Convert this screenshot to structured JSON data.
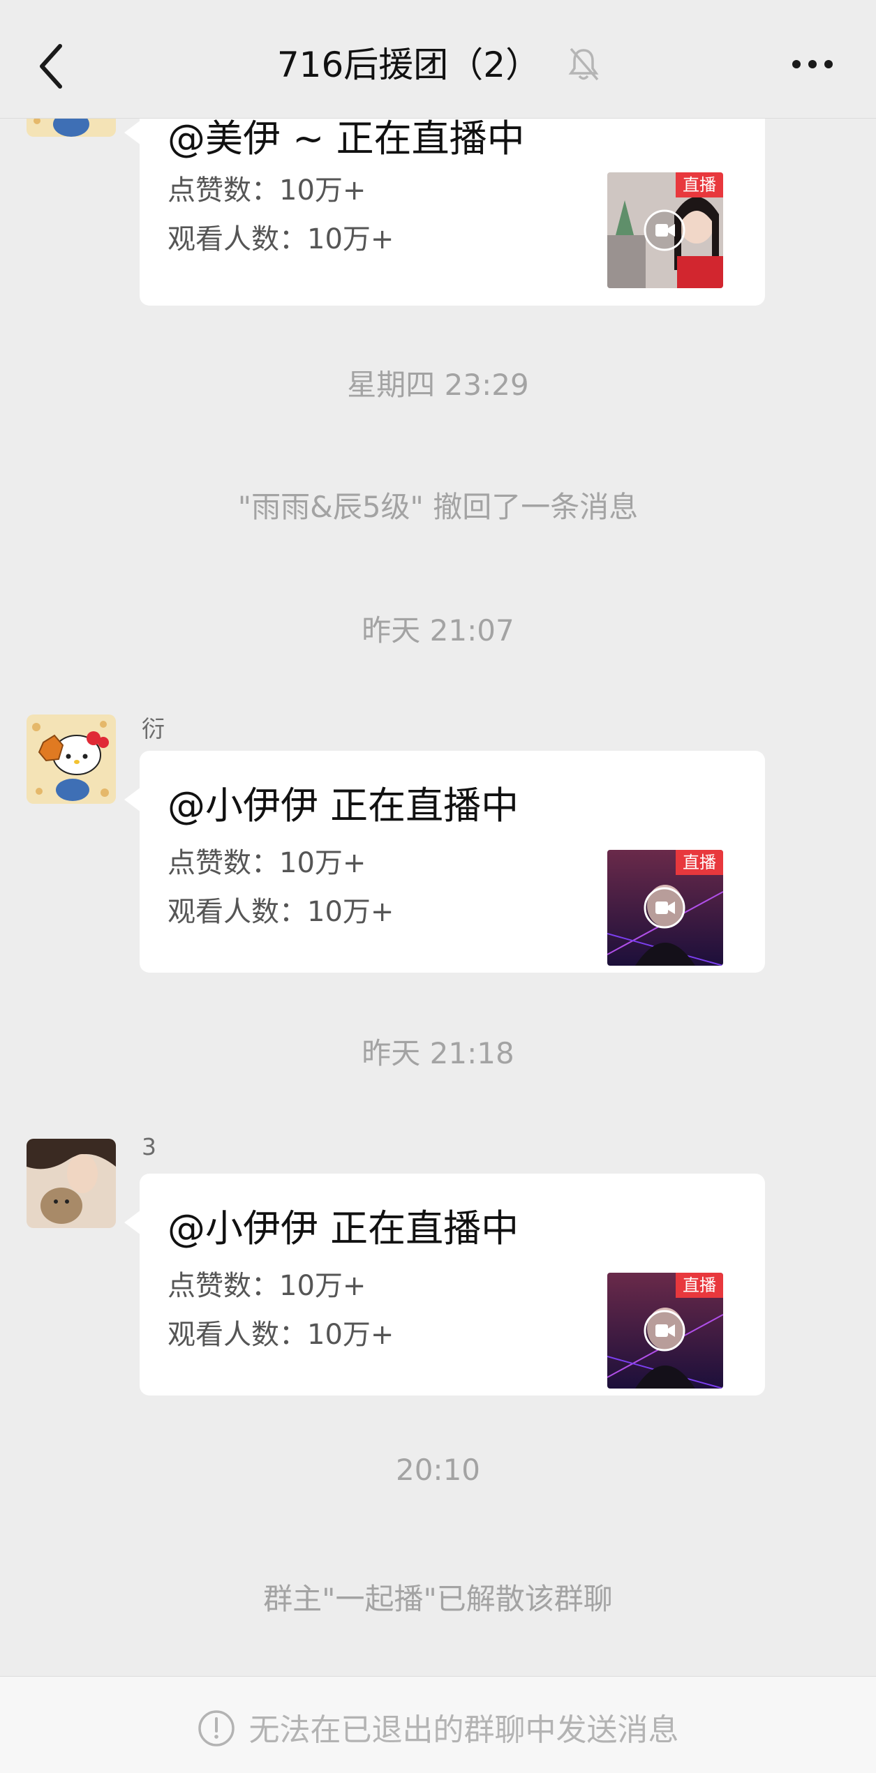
{
  "header": {
    "title": "716后援团（2）",
    "back_icon": "chevron-left-icon",
    "mute_icon": "bell-off-icon",
    "more_icon": "more-dots-icon"
  },
  "messages": [
    {
      "sender": "",
      "card_title": "@美伊 ~ 正在直播中",
      "likes_label": "点赞数：",
      "likes_value": "10万+",
      "viewers_label": "观看人数：",
      "viewers_value": "10万+",
      "live_tag": "直播"
    },
    {
      "sender": "衍",
      "card_title": "@小伊伊 正在直播中",
      "likes_label": "点赞数：",
      "likes_value": "10万+",
      "viewers_label": "观看人数：",
      "viewers_value": "10万+",
      "live_tag": "直播"
    },
    {
      "sender": "3",
      "card_title": "@小伊伊 正在直播中",
      "likes_label": "点赞数：",
      "likes_value": "10万+",
      "viewers_label": "观看人数：",
      "viewers_value": "10万+",
      "live_tag": "直播"
    }
  ],
  "timestamps": {
    "t1": "星期四 23:29",
    "t2": "昨天 21:07",
    "t3": "昨天 21:18",
    "t4": "20:10"
  },
  "system": {
    "recall": "\"雨雨&辰5级\" 撤回了一条消息",
    "disband": "群主\"一起播\"已解散该群聊"
  },
  "footer": {
    "text": "无法在已退出的群聊中发送消息",
    "icon": "exclamation-circle-icon"
  },
  "colors": {
    "background": "#ededed",
    "card": "#ffffff",
    "live_tag": "#e8383d",
    "system_text": "#a3a3a3"
  }
}
